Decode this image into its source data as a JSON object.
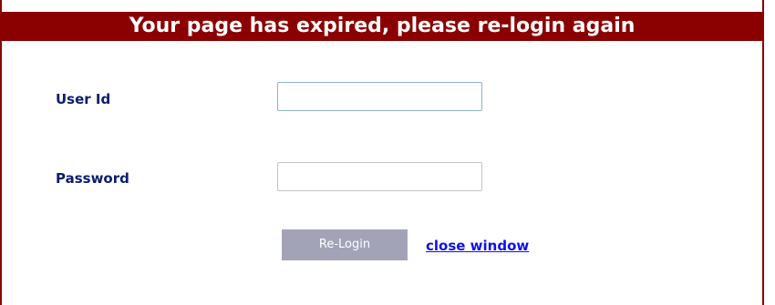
{
  "header": {
    "title": "Your page has expired, please re-login again"
  },
  "form": {
    "user_id_label": "User Id",
    "user_id_value": "",
    "password_label": "Password",
    "password_value": "",
    "relogin_label": "Re-Login",
    "close_label": "close window"
  },
  "colors": {
    "title_bar": "#8b0000",
    "label_text": "#0a1e6e",
    "button_bg": "#a3a3b8",
    "link": "#1010ee"
  }
}
